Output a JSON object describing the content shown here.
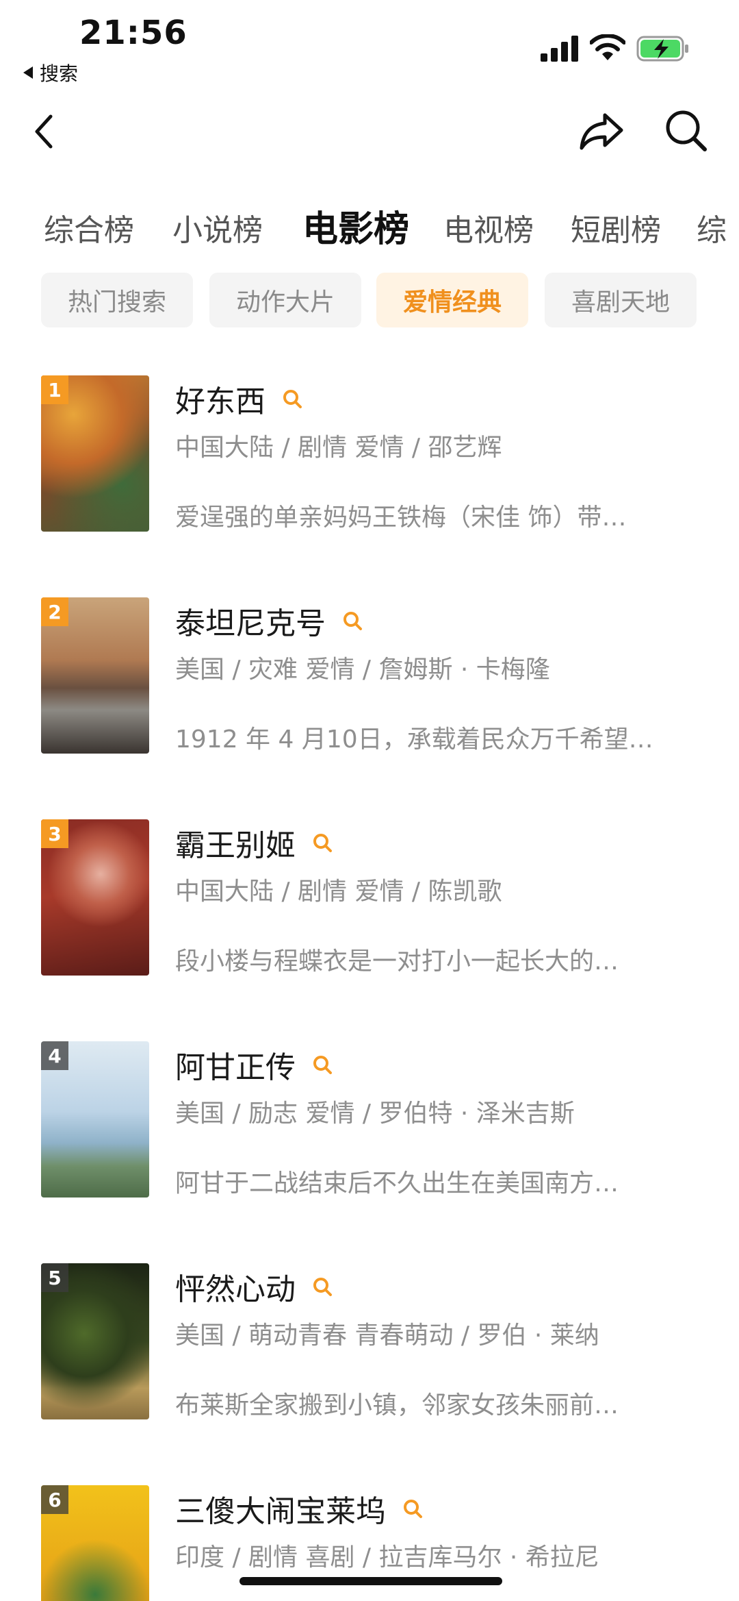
{
  "status_bar": {
    "time": "21:56",
    "back_app_label": "搜索",
    "icons": [
      "signal-icon",
      "wifi-icon",
      "battery-charging-icon"
    ]
  },
  "nav": {
    "icons": [
      "back-chevron-icon",
      "share-icon",
      "search-icon"
    ]
  },
  "category_tabs": [
    {
      "label": "综合榜",
      "active": false
    },
    {
      "label": "小说榜",
      "active": false
    },
    {
      "label": "电影榜",
      "active": true
    },
    {
      "label": "电视榜",
      "active": false
    },
    {
      "label": "短剧榜",
      "active": false
    },
    {
      "label": "综",
      "active": false
    }
  ],
  "sub_tags": [
    {
      "label": "热门搜索",
      "active": false
    },
    {
      "label": "动作大片",
      "active": false
    },
    {
      "label": "爱情经典",
      "active": true
    },
    {
      "label": "喜剧天地",
      "active": false
    }
  ],
  "movies": [
    {
      "rank": "1",
      "title": "好东西",
      "meta": "中国大陆 / 剧情 爱情 / 邵艺辉",
      "desc": "爱逞强的单亲妈妈王铁梅（宋佳 饰）带…"
    },
    {
      "rank": "2",
      "title": "泰坦尼克号",
      "meta": "美国 / 灾难 爱情 / 詹姆斯 · 卡梅隆",
      "desc": "1912 年 4 月10日，承载着民众万千希望…"
    },
    {
      "rank": "3",
      "title": "霸王别姬",
      "meta": "中国大陆 / 剧情 爱情 / 陈凯歌",
      "desc": "段小楼与程蝶衣是一对打小一起长大的…"
    },
    {
      "rank": "4",
      "title": "阿甘正传",
      "meta": "美国 / 励志 爱情 / 罗伯特 · 泽米吉斯",
      "desc": "阿甘于二战结束后不久出生在美国南方…"
    },
    {
      "rank": "5",
      "title": "怦然心动",
      "meta": "美国 / 萌动青春 青春萌动 / 罗伯 · 莱纳",
      "desc": "布莱斯全家搬到小镇，邻家女孩朱丽前…"
    },
    {
      "rank": "6",
      "title": "三傻大闹宝莱坞",
      "meta": "印度 / 剧情 喜剧 / 拉吉库马尔 · 希拉尼",
      "desc": ""
    }
  ],
  "colors": {
    "accent": "#f59a23",
    "tag_active_bg": "#fff3e3",
    "tag_active_text": "#f0901e",
    "secondary_text": "#8e8e8e"
  }
}
